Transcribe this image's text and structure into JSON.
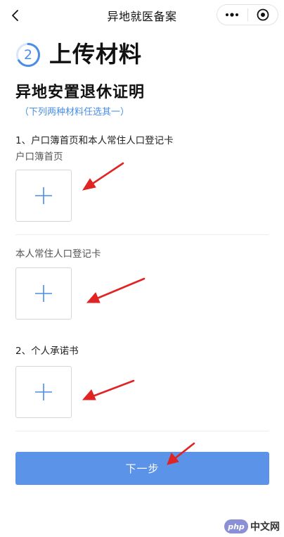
{
  "nav": {
    "title": "异地就医备案",
    "back_icon": "chevron-left-icon",
    "more_icon": "more-dots-icon",
    "close_icon": "target-close-icon"
  },
  "step": {
    "number": "2",
    "title": "上传材料"
  },
  "section": {
    "title": "异地安置退休证明",
    "note": "（下列两种材料任选其一）"
  },
  "items": [
    {
      "heading": "1、户口簿首页和本人常住人口登记卡",
      "fields": [
        {
          "label": "户口簿首页"
        },
        {
          "label": "本人常住人口登记卡"
        }
      ]
    },
    {
      "heading": "2、个人承诺书",
      "fields": []
    }
  ],
  "next_button": {
    "label": "下一步"
  },
  "watermark": {
    "badge": "php",
    "text": "中文网"
  },
  "colors": {
    "accent": "#4a8ee6",
    "button": "#5b93e8",
    "annotation_arrow": "#e02424"
  }
}
